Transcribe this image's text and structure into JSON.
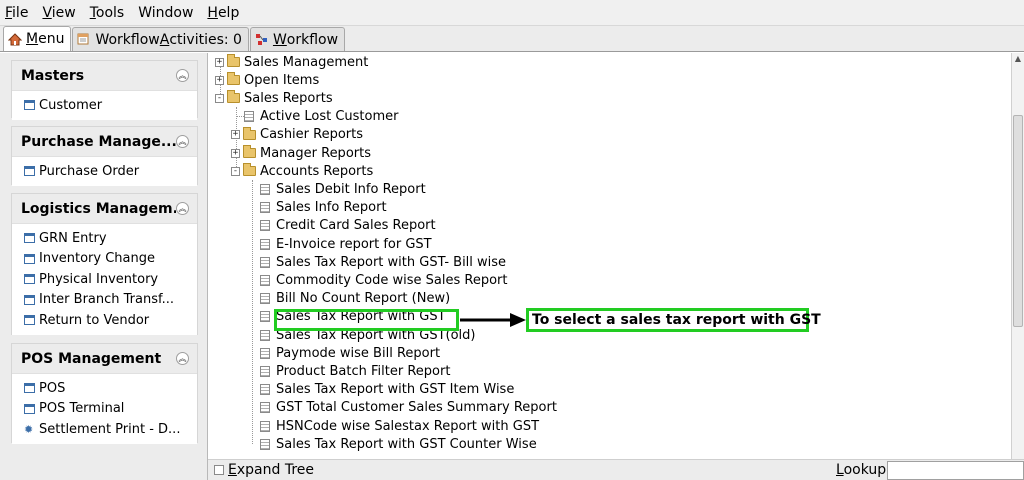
{
  "menubar": {
    "items": [
      {
        "label": "File",
        "mnemonic_first": "F",
        "rest": "ile"
      },
      {
        "label": "View",
        "mnemonic_first": "V",
        "rest": "iew"
      },
      {
        "label": "Tools",
        "mnemonic_first": "T",
        "rest": "ools"
      },
      {
        "label": "Window",
        "mnemonic_first": "",
        "rest": "Window"
      },
      {
        "label": "Help",
        "mnemonic_first": "H",
        "rest": "elp"
      }
    ]
  },
  "tabs": [
    {
      "label_mn": "M",
      "label_rest": "enu",
      "icon": "home-icon",
      "active": true
    },
    {
      "label_pre": "Workflow ",
      "label_mn": "A",
      "label_rest": "ctivities: 0",
      "icon": "calendar-icon",
      "active": false
    },
    {
      "label_mn": "W",
      "label_rest": "orkflow",
      "icon": "workflow-icon",
      "active": false
    }
  ],
  "sidebar": {
    "sections": [
      {
        "title": "Masters",
        "items": [
          {
            "label": "Customer",
            "icon": "form-icon"
          }
        ]
      },
      {
        "title": "Purchase Manage...",
        "items": [
          {
            "label": "Purchase Order",
            "icon": "form-icon"
          }
        ]
      },
      {
        "title": "Logistics Managem...",
        "items": [
          {
            "label": "GRN Entry",
            "icon": "form-icon"
          },
          {
            "label": "Inventory Change",
            "icon": "form-icon"
          },
          {
            "label": "Physical Inventory",
            "icon": "form-icon"
          },
          {
            "label": "Inter Branch Transf...",
            "icon": "form-icon"
          },
          {
            "label": "Return to Vendor",
            "icon": "form-icon"
          }
        ]
      },
      {
        "title": "POS Management",
        "items": [
          {
            "label": "POS",
            "icon": "form-icon"
          },
          {
            "label": "POS Terminal",
            "icon": "form-icon"
          },
          {
            "label": "Settlement Print - D...",
            "icon": "gear-icon"
          }
        ]
      }
    ]
  },
  "tree": {
    "nodes": [
      {
        "label": "Sales Management",
        "type": "folder",
        "expander": "+"
      },
      {
        "label": "Open Items",
        "type": "folder",
        "expander": "+"
      },
      {
        "label": "Sales Reports",
        "type": "folder-open",
        "expander": "-"
      },
      {
        "label": "Active Lost Customer",
        "type": "doc"
      },
      {
        "label": "Cashier Reports",
        "type": "folder",
        "expander": "+"
      },
      {
        "label": "Manager Reports",
        "type": "folder",
        "expander": "+"
      },
      {
        "label": "Accounts Reports",
        "type": "folder-open",
        "expander": "-"
      },
      {
        "label": "Sales Debit Info Report",
        "type": "doc"
      },
      {
        "label": "Sales Info Report",
        "type": "doc"
      },
      {
        "label": "Credit Card Sales Report",
        "type": "doc"
      },
      {
        "label": "E-Invoice report for GST",
        "type": "doc"
      },
      {
        "label": "Sales Tax Report with GST- Bill wise",
        "type": "doc"
      },
      {
        "label": "Commodity Code wise Sales Report",
        "type": "doc"
      },
      {
        "label": "Bill No Count Report (New)",
        "type": "doc"
      },
      {
        "label": "Sales Tax Report with GST",
        "type": "doc"
      },
      {
        "label": "Sales Tax Report with GST(old)",
        "type": "doc"
      },
      {
        "label": "Paymode wise Bill Report",
        "type": "doc"
      },
      {
        "label": "Product Batch Filter Report",
        "type": "doc"
      },
      {
        "label": "Sales Tax Report with GST Item Wise",
        "type": "doc"
      },
      {
        "label": "GST Total Customer Sales Summary Report",
        "type": "doc"
      },
      {
        "label": "HSNCode wise Salestax Report with GST",
        "type": "doc"
      },
      {
        "label": "Sales Tax Report with GST Counter Wise",
        "type": "doc"
      }
    ]
  },
  "bottombar": {
    "expand_mn": "E",
    "expand_rest": "xpand Tree",
    "lookup_mn": "L",
    "lookup_rest": "ookup",
    "lookup_value": ""
  },
  "annotation": {
    "text": "To select a sales tax report with GST"
  },
  "colors": {
    "highlight": "#22cc22",
    "folder": "#e9c46a",
    "icon_blue": "#3c6ea8"
  }
}
